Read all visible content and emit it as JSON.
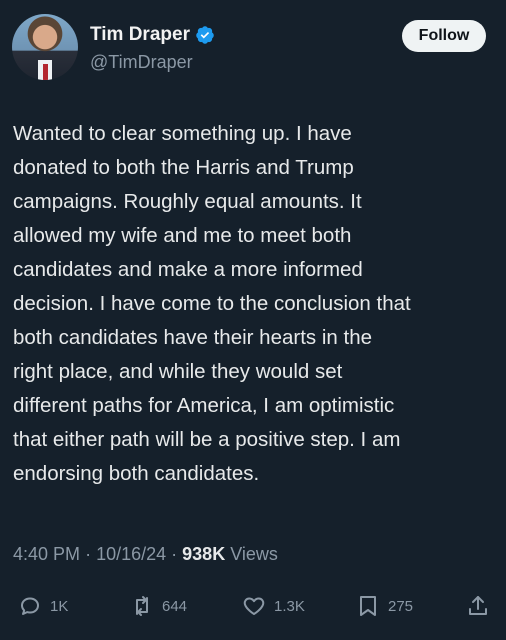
{
  "author": {
    "name": "Tim Draper",
    "handle": "@TimDraper",
    "verified": true
  },
  "follow_button": {
    "label": "Follow"
  },
  "tweet": {
    "text": "Wanted to clear something up. I have\ndonated to both the Harris and Trump\ncampaigns. Roughly equal amounts. It\nallowed my wife and me to meet both\ncandidates and make a more informed\ndecision. I have come to the conclusion that\nboth candidates have their hearts in the\nright place, and while they would set\ndifferent paths for America, I am optimistic\nthat either path will be a positive step. I am\nendorsing both candidates."
  },
  "meta": {
    "time": "4:40 PM",
    "date": "10/16/24",
    "views_count": "938K",
    "views_label": "Views"
  },
  "actions": {
    "replies": "1K",
    "reposts": "644",
    "likes": "1.3K",
    "bookmarks": "275"
  },
  "colors": {
    "background": "#15202b",
    "text": "#e7e9ea",
    "secondary": "#8b98a5",
    "verified": "#1d9bf0"
  }
}
